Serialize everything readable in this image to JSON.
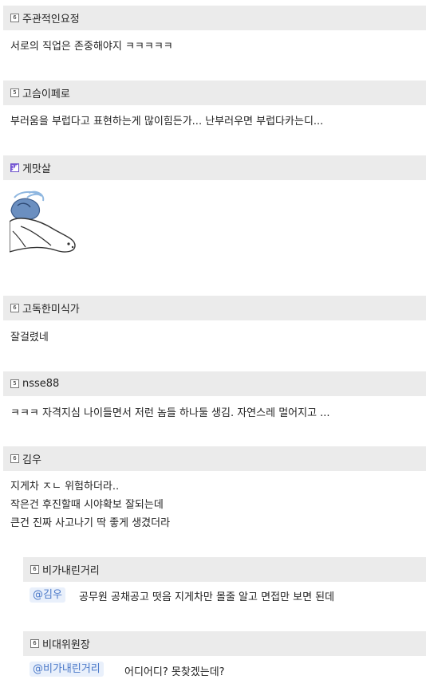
{
  "comments": [
    {
      "level": "6",
      "nick": "주관적인요정",
      "lines": [
        "서로의 직업은 존중해야지 ㅋㅋㅋㅋㅋ"
      ]
    },
    {
      "level": "5",
      "nick": "고슴이페로",
      "lines": [
        "부러움을 부럽다고 표현하는게 많이힘든가... 난부러우면 부럽다카는디..."
      ]
    },
    {
      "level": "10",
      "nick": "게맛살",
      "sticker": "seal-lying-sticker"
    },
    {
      "level": "6",
      "nick": "고독한미식가",
      "lines": [
        "잘걸렸네"
      ]
    },
    {
      "level": "5",
      "nick": "nsse88",
      "lines": [
        "ㅋㅋㅋ 자격지심 나이들면서 저런 놈들 하나둘 생김. 자연스레 멀어지고 ..."
      ]
    },
    {
      "level": "6",
      "nick": "김우",
      "lines": [
        "지게차 ㅈㄴ 위험하더라..",
        "작은건 후진할때 시야확보 잘되는데",
        "큰건 진짜 사고나기 딱 좋게 생겼더라"
      ]
    }
  ],
  "replies": [
    {
      "level": "6",
      "nick": "비가내린거리",
      "mention": "@김우",
      "text": "공무원 공채공고 떳음 지게차만 몰줄 알고 면접만 보면 된데"
    },
    {
      "level": "6",
      "nick": "비대위원장",
      "mention": "@비가내린거리",
      "text": "어디어디? 못찾겠는데?"
    }
  ]
}
